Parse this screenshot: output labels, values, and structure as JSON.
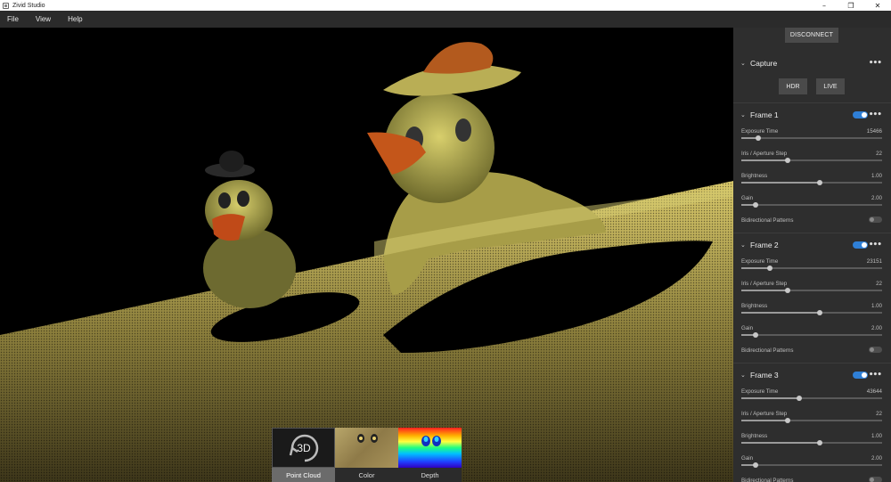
{
  "window": {
    "title": "Zivid Studio",
    "controls": [
      "–",
      "❐",
      "✕"
    ]
  },
  "menu": [
    "File",
    "View",
    "Help"
  ],
  "viewport": {
    "views": [
      {
        "label": "Point Cloud",
        "badge": "3D",
        "active": true
      },
      {
        "label": "Color",
        "active": false
      },
      {
        "label": "Depth",
        "active": false
      }
    ]
  },
  "panel": {
    "disconnect_label": "DISCONNECT",
    "capture": {
      "title": "Capture",
      "hdr_label": "HDR",
      "live_label": "LIVE"
    },
    "frames": [
      {
        "title": "Frame 1",
        "enabled": true,
        "settings": [
          {
            "label": "Exposure Time",
            "value": "15466",
            "level": 0.12
          },
          {
            "label": "Iris / Aperture Step",
            "value": "22",
            "level": 0.33
          },
          {
            "label": "Brightness",
            "value": "1.00",
            "level": 0.56
          },
          {
            "label": "Gain",
            "value": "2.00",
            "level": 0.1
          }
        ],
        "bidirectional_label": "Bidirectional Patterns",
        "bidirectional": false
      },
      {
        "title": "Frame 2",
        "enabled": true,
        "settings": [
          {
            "label": "Exposure Time",
            "value": "23151",
            "level": 0.2
          },
          {
            "label": "Iris / Aperture Step",
            "value": "22",
            "level": 0.33
          },
          {
            "label": "Brightness",
            "value": "1.00",
            "level": 0.56
          },
          {
            "label": "Gain",
            "value": "2.00",
            "level": 0.1
          }
        ],
        "bidirectional_label": "Bidirectional Patterns",
        "bidirectional": false
      },
      {
        "title": "Frame 3",
        "enabled": true,
        "settings": [
          {
            "label": "Exposure Time",
            "value": "43644",
            "level": 0.41
          },
          {
            "label": "Iris / Aperture Step",
            "value": "22",
            "level": 0.33
          },
          {
            "label": "Brightness",
            "value": "1.00",
            "level": 0.56
          },
          {
            "label": "Gain",
            "value": "2.00",
            "level": 0.1
          }
        ],
        "bidirectional_label": "Bidirectional Patterns",
        "bidirectional": false
      }
    ]
  }
}
